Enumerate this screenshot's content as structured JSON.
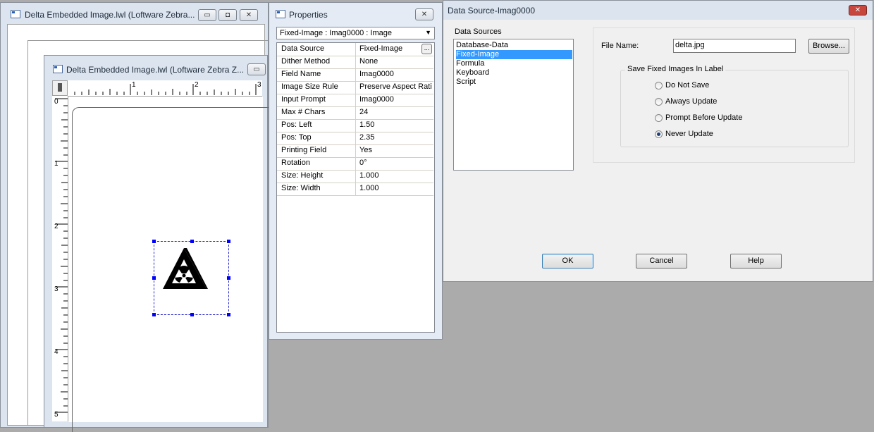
{
  "editor_window_back": {
    "title": "Delta Embedded Image.lwl (Loftware Zebra..."
  },
  "editor_window_front": {
    "title": "Delta Embedded Image.lwl (Loftware Zebra Z...",
    "ruler_h_numbers": [
      "1",
      "2",
      "3"
    ],
    "ruler_v_numbers": [
      "0",
      "1",
      "2",
      "3",
      "4",
      "5"
    ]
  },
  "properties": {
    "title": "Properties",
    "close_label": "✕",
    "selector_value": "Fixed-Image : Imag0000 : Image",
    "browse_ellipsis": "...",
    "rows": [
      {
        "key": "Data Source",
        "value": "Fixed-Image"
      },
      {
        "key": "Dither Method",
        "value": "None"
      },
      {
        "key": "Field Name",
        "value": "Imag0000"
      },
      {
        "key": "Image Size Rule",
        "value": "Preserve  Aspect Rati"
      },
      {
        "key": "Input Prompt",
        "value": "Imag0000"
      },
      {
        "key": "Max # Chars",
        "value": "24"
      },
      {
        "key": "Pos: Left",
        "value": "1.50"
      },
      {
        "key": "Pos: Top",
        "value": "2.35"
      },
      {
        "key": "Printing Field",
        "value": "Yes"
      },
      {
        "key": "Rotation",
        "value": "0°"
      },
      {
        "key": "Size: Height",
        "value": "1.000"
      },
      {
        "key": "Size: Width",
        "value": "1.000"
      }
    ]
  },
  "dialog": {
    "title": "Data Source-Imag0000",
    "close_label": "✕",
    "sources_label": "Data Sources",
    "sources": [
      "Database-Data",
      "Fixed-Image",
      "Formula",
      "Keyboard",
      "Script"
    ],
    "selected_source_index": 1,
    "file_name_label": "File Name:",
    "file_name_value": "delta.jpg",
    "browse_label": "Browse...",
    "save_group_label": "Save Fixed Images In Label",
    "save_options": [
      "Do Not Save",
      "Always Update",
      "Prompt Before Update",
      "Never Update"
    ],
    "save_selected_index": 3,
    "ok_label": "OK",
    "cancel_label": "Cancel",
    "help_label": "Help"
  },
  "colors": {
    "selection": "#3399ff",
    "desktop": "#ababab",
    "frame": "#dbe4ef",
    "dialog_close": "#c7463e"
  }
}
